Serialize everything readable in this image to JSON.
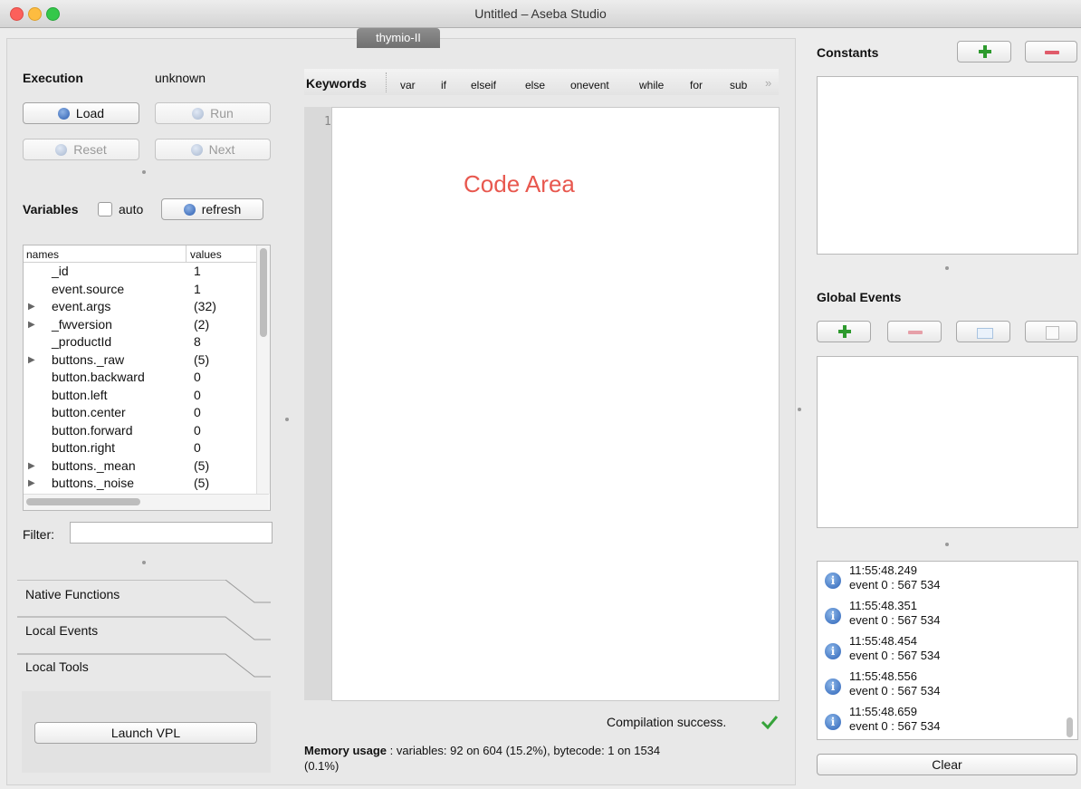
{
  "window": {
    "title": "Untitled – Aseba Studio",
    "colors": {
      "close": "#fc605b",
      "minimize": "#fdbc40",
      "zoom": "#34c84a"
    }
  },
  "node_tab": {
    "label": "thymio-II"
  },
  "execution": {
    "label": "Execution",
    "status": "unknown",
    "load_label": "Load",
    "run_label": "Run",
    "reset_label": "Reset",
    "next_label": "Next"
  },
  "variables": {
    "label": "Variables",
    "auto_label": "auto",
    "refresh_label": "refresh",
    "col_names": "names",
    "col_values": "values",
    "rows": [
      {
        "name": "_id",
        "value": "1",
        "expandable": false
      },
      {
        "name": "event.source",
        "value": "1",
        "expandable": false
      },
      {
        "name": "event.args",
        "value": "(32)",
        "expandable": true
      },
      {
        "name": "_fwversion",
        "value": "(2)",
        "expandable": true
      },
      {
        "name": "_productId",
        "value": "8",
        "expandable": false
      },
      {
        "name": "buttons._raw",
        "value": "(5)",
        "expandable": true
      },
      {
        "name": "button.backward",
        "value": "0",
        "expandable": false
      },
      {
        "name": "button.left",
        "value": "0",
        "expandable": false
      },
      {
        "name": "button.center",
        "value": "0",
        "expandable": false
      },
      {
        "name": "button.forward",
        "value": "0",
        "expandable": false
      },
      {
        "name": "button.right",
        "value": "0",
        "expandable": false
      },
      {
        "name": "buttons._mean",
        "value": "(5)",
        "expandable": true
      },
      {
        "name": "buttons._noise",
        "value": "(5)",
        "expandable": true
      }
    ],
    "filter_label": "Filter:",
    "filter_value": ""
  },
  "toolbox_tabs": [
    "Native Functions",
    "Local Events",
    "Local Tools"
  ],
  "launch_vpl_label": "Launch VPL",
  "keywords": {
    "label": "Keywords",
    "items": [
      "var",
      "if",
      "elseif",
      "else",
      "onevent",
      "while",
      "for",
      "sub"
    ],
    "more": "»"
  },
  "editor": {
    "line_number": "1",
    "overlay_label": "Code Area",
    "overlay_color": "#e8584f"
  },
  "compilation_status": "Compilation success.",
  "memory": {
    "label": "Memory usage",
    "text": " : variables: 92 on 604 (15.2%), bytecode: 1 on 1534",
    "text2": "(0.1%)"
  },
  "constants": {
    "label": "Constants"
  },
  "global_events": {
    "label": "Global Events"
  },
  "log": [
    {
      "time": "11:55:48.249",
      "msg": "event 0 : 567 534"
    },
    {
      "time": "11:55:48.351",
      "msg": "event 0 : 567 534"
    },
    {
      "time": "11:55:48.454",
      "msg": "event 0 : 567 534"
    },
    {
      "time": "11:55:48.556",
      "msg": "event 0 : 567 534"
    },
    {
      "time": "11:55:48.659",
      "msg": "event 0 : 567 534"
    }
  ],
  "clear_label": "Clear"
}
